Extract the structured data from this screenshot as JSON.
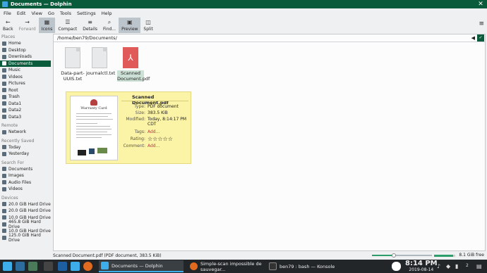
{
  "window": {
    "title": "Documents — Dolphin"
  },
  "menu": [
    "File",
    "Edit",
    "View",
    "Go",
    "Tools",
    "Settings",
    "Help"
  ],
  "toolbar": {
    "back": "Back",
    "forward": "Forward",
    "icons": "Icons",
    "compact": "Compact",
    "details": "Details",
    "find": "Find...",
    "preview": "Preview",
    "split": "Split"
  },
  "sidebar": {
    "places_header": "Places",
    "places": [
      "Home",
      "Desktop",
      "Downloads",
      "Documents",
      "Music",
      "Videos",
      "Pictures",
      "Root",
      "Trash",
      "Data1",
      "Data2",
      "Data3"
    ],
    "remote_header": "Remote",
    "remote": [
      "Network"
    ],
    "recent_header": "Recently Saved",
    "recent": [
      "Today",
      "Yesterday"
    ],
    "search_header": "Search For",
    "search": [
      "Documents",
      "Images",
      "Audio Files",
      "Videos"
    ],
    "devices_header": "Devices",
    "devices": [
      "20.0 GiB Hard Drive",
      "20.0 GiB Hard Drive",
      "10.0 GiB Hard Drive",
      "465.8 GiB Hard Drive",
      "10.0 GiB Hard Drive",
      "125.0 GiB Hard Drive"
    ]
  },
  "location": {
    "path": "/home/ben79/Documents/"
  },
  "files": [
    {
      "name": "Data-part-UUIS.txt",
      "type": "txt"
    },
    {
      "name": "journalctl.txt",
      "type": "txt"
    },
    {
      "name": "Scanned Document.pdf",
      "type": "pdf"
    }
  ],
  "tooltip": {
    "name": "Scanned Document.pdf",
    "thumb_title": "Warranty Card",
    "rows": [
      {
        "key": "Type:",
        "value": "PDF document"
      },
      {
        "key": "Size:",
        "value": "383.5 KiB"
      },
      {
        "key": "Modified:",
        "value": "Today, 8:14:17 PM CDT"
      },
      {
        "key": "Tags:",
        "value": "Add..."
      },
      {
        "key": "Rating:",
        "value": "☆☆☆☆☆"
      },
      {
        "key": "Comment:",
        "value": "Add..."
      }
    ]
  },
  "status": {
    "text": "Scanned Document.pdf (PDF document, 383.5 KiB)",
    "free": "8.1 GiB free",
    "zoom_level": 0.35
  },
  "taskbar": {
    "tasks": [
      "Documents — Dolphin",
      "Simple-scan impossible de sauvegar...",
      "ben79 : bash — Konsole"
    ],
    "time": "8:14 PM",
    "date": "2019-08-14",
    "desktop_num": "2"
  },
  "colors": {
    "accent": "#0a5b3c",
    "tooltip_bg": "#fbf3a5",
    "taskbar": "#232629"
  }
}
